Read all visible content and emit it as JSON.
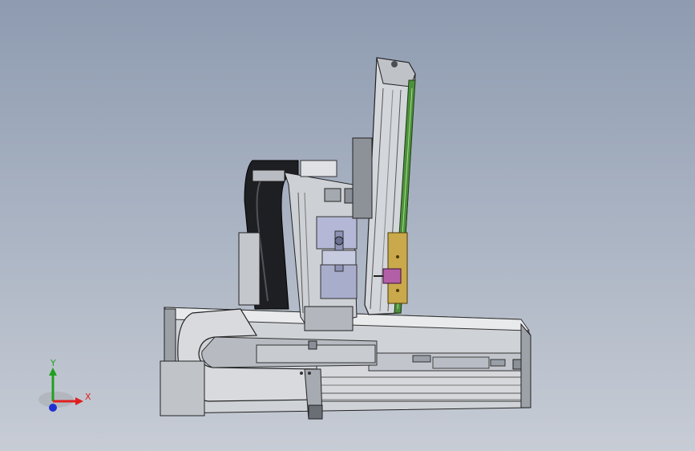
{
  "viewport": {
    "background_top": "#8e9bb0",
    "background_bottom": "#c7ccd5"
  },
  "triad": {
    "x_label": "X",
    "y_label": "Y",
    "x_color": "#e02020",
    "y_color": "#20a020",
    "z_color": "#2030d0"
  },
  "model": {
    "parts": [
      "vertical-column",
      "horizontal-base-rail",
      "cable-chain-loop",
      "cable-chain-upright",
      "carriage-block",
      "motor-assembly",
      "brass-plate"
    ]
  }
}
